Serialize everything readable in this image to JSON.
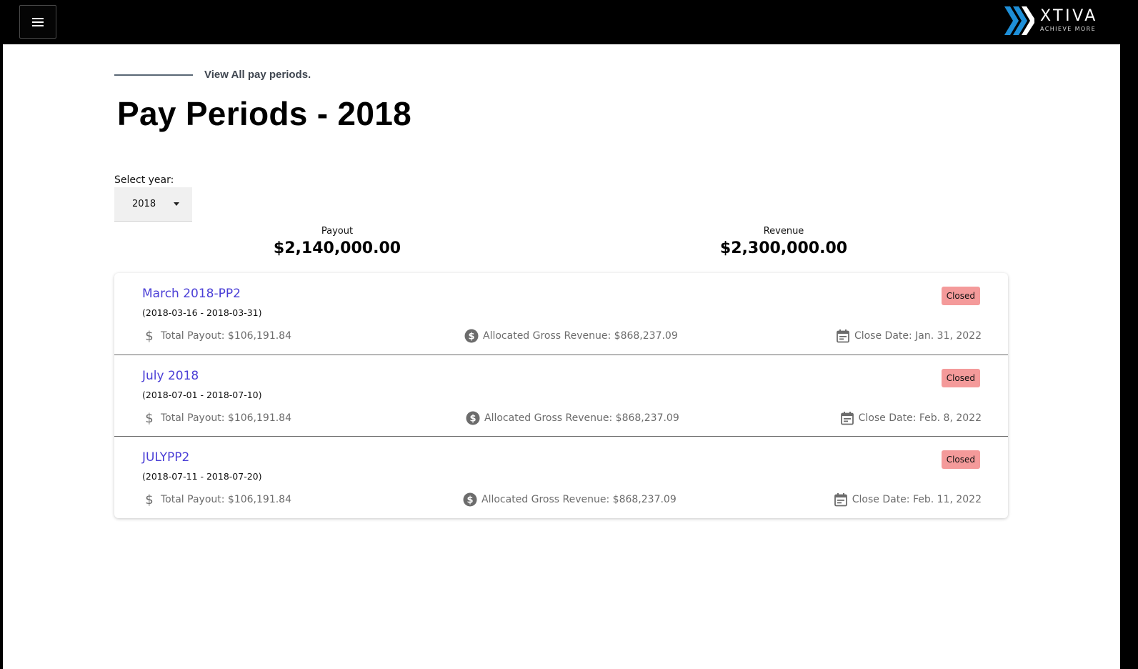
{
  "header": {
    "menu_icon": "hamburger-menu-icon",
    "logo": {
      "name": "XTIVA",
      "tagline": "ACHIEVE MORE",
      "accent": "#1e8fd8"
    }
  },
  "back_link": "View All pay periods.",
  "page_title": "Pay Periods - 2018",
  "year_select": {
    "label": "Select year:",
    "value": "2018"
  },
  "summary": {
    "payout": {
      "label": "Payout",
      "value": "$2,140,000.00"
    },
    "revenue": {
      "label": "Revenue",
      "value": "$2,300,000.00"
    }
  },
  "periods": [
    {
      "name": "March 2018-PP2",
      "range": "(2018-03-16 - 2018-03-31)",
      "status": "Closed",
      "payout": "Total Payout: $106,191.84",
      "revenue": "Allocated Gross Revenue: $868,237.09",
      "close": "Close Date: Jan. 31, 2022"
    },
    {
      "name": "July 2018",
      "range": "(2018-07-01 - 2018-07-10)",
      "status": "Closed",
      "payout": "Total Payout: $106,191.84",
      "revenue": "Allocated Gross Revenue: $868,237.09",
      "close": "Close Date: Feb. 8, 2022"
    },
    {
      "name": "JULYPP2",
      "range": "(2018-07-11 - 2018-07-20)",
      "status": "Closed",
      "payout": "Total Payout: $106,191.84",
      "revenue": "Allocated Gross Revenue: $868,237.09",
      "close": "Close Date: Feb. 11, 2022"
    }
  ],
  "colors": {
    "link": "#4a3ed6",
    "badge_closed": "#f49a9a",
    "meta_text": "#6c6c6c"
  },
  "icons": {
    "payout": "dollar-icon",
    "revenue": "dollar-circle-icon",
    "close": "calendar-icon"
  }
}
